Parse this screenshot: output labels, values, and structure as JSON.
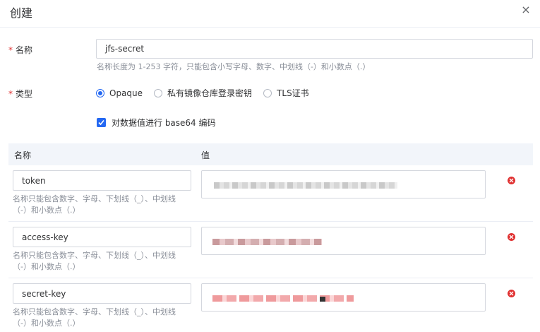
{
  "dialog": {
    "title": "创建",
    "close_symbol": "×"
  },
  "form": {
    "name": {
      "label": "名称",
      "value": "jfs-secret",
      "hint": "名称长度为 1-253 字符，只能包含小写字母、数字、中划线（-）和小数点（.）"
    },
    "type": {
      "label": "类型",
      "options": [
        {
          "label": "Opaque",
          "checked": true
        },
        {
          "label": "私有镜像仓库登录密钥",
          "checked": false
        },
        {
          "label": "TLS证书",
          "checked": false
        }
      ]
    },
    "base64": {
      "label": "对数据值进行 base64 编码",
      "checked": true
    }
  },
  "table": {
    "header_name": "名称",
    "header_value": "值",
    "rows": [
      {
        "key": "token",
        "hint_line1": "名称只能包含数字、字母、下划线（_）、中划线",
        "hint_line2": "（-）和小数点（.）"
      },
      {
        "key": "access-key",
        "hint_line1": "名称只能包含数字、字母、下划线（_）、中划线",
        "hint_line2": "（-）和小数点（.）"
      },
      {
        "key": "secret-key",
        "hint_line1": "名称只能包含数字、字母、下划线（_）、中划线",
        "hint_line2": "（-）和小数点（.）"
      }
    ]
  },
  "icons": {
    "close": "close-icon",
    "delete": "delete-circle-icon",
    "check": "check-icon"
  },
  "colors": {
    "primary": "#2468f2",
    "danger": "#e03131",
    "required": "#e03131",
    "header_bg": "#f2f5fa",
    "hint_text": "#8a8f99"
  }
}
